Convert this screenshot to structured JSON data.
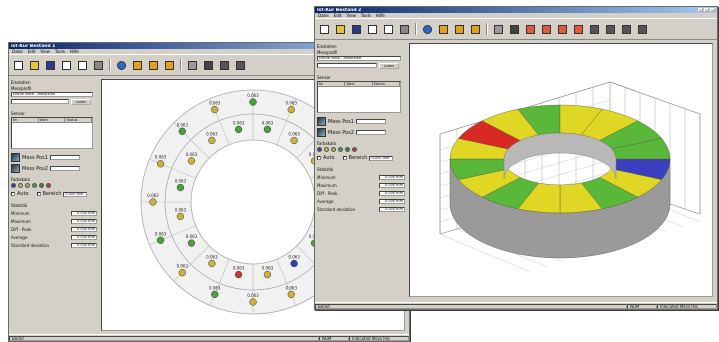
{
  "window1": {
    "title": "Ist-Kur Bestand 1",
    "menu": [
      "Datei",
      "Edit",
      "View",
      "Tools",
      "Hilfe"
    ],
    "toolbar_icons": [
      "new-icon",
      "open-icon",
      "save-icon",
      "copy-icon",
      "paste-icon",
      "print-icon",
      "info-icon",
      "folder-a-icon",
      "folder-b-icon",
      "folder-c-icon",
      "grid-icon",
      "link-icon",
      "tool-a-icon",
      "tool-b-icon"
    ],
    "panel": {
      "settings_label": "Einstellen",
      "profile_label": "Messprofil",
      "profile_value": "Ebene Mitte - Messreihe",
      "load_button": "Laden",
      "sensor_label": "Sensor",
      "list_headers": [
        "Nr",
        "Wert",
        "Status"
      ],
      "sensor1_label": "Mess Pos1",
      "sensor2_label": "Mess Pos2",
      "colors_label": "Farbskala",
      "auto_label": "Auto",
      "range_label": "Bereich",
      "range_value": "0.000 mm",
      "stats_label": "Statistik",
      "stats": [
        {
          "label": "Minimum",
          "value": "0.000 mm"
        },
        {
          "label": "Maximum",
          "value": "0.000 mm"
        },
        {
          "label": "Diff - Peak",
          "value": "0.000 mm"
        },
        {
          "label": "Average",
          "value": "0.000 mm"
        },
        {
          "label": "Standard deviation",
          "value": "0.000 mm"
        }
      ]
    },
    "status": [
      "Bereit",
      "NUM",
      "Indicated Mess Pos"
    ]
  },
  "window2": {
    "title": "Ist-Kur Bestand 2",
    "menu": [
      "Datei",
      "Edit",
      "View",
      "Tools",
      "Hilfe"
    ],
    "toolbar_icons": [
      "new-icon",
      "open-icon",
      "save-icon",
      "copy-icon",
      "paste-icon",
      "print-icon",
      "info-icon",
      "folder-a-icon",
      "folder-b-icon",
      "folder-c-icon",
      "grid-icon",
      "link-icon",
      "box-a-icon",
      "box-b-icon",
      "box-c-icon",
      "box-d-icon",
      "tool-a-icon",
      "tool-b-icon",
      "tool-c-icon",
      "tool-d-icon"
    ],
    "panel": {
      "settings_label": "Einstellen",
      "profile_label": "Messprofil",
      "profile_value": "Ebene Mitte - Messreihe",
      "load_button": "Laden",
      "sensor_label": "Sensor",
      "list_headers": [
        "Nr",
        "Wert",
        "Status"
      ],
      "sensor1_label": "Mess Pos1",
      "sensor2_label": "Mess Pos2",
      "colors_label": "Farbskala",
      "auto_label": "Auto",
      "range_label": "Bereich",
      "range_value": "0.000 mm",
      "stats_label": "Statistik",
      "stats": [
        {
          "label": "Minimum",
          "value": "0.000 mm"
        },
        {
          "label": "Maximum",
          "value": "0.000 mm"
        },
        {
          "label": "Diff - Peak",
          "value": "0.000 mm"
        },
        {
          "label": "Average",
          "value": "0.000 mm"
        },
        {
          "label": "Standard deviation",
          "value": "0.000 mm"
        }
      ]
    },
    "status": [
      "Bereit",
      "NUM",
      "Indicated Mess Pos"
    ]
  },
  "legend_colors": [
    "#2f3fb0",
    "#c9b33a",
    "#9bbf3a",
    "#4aa23a",
    "#2f8f3a",
    "#c63a2a"
  ],
  "ring_points": [
    {
      "label": "0.063",
      "color": "#4aa23a"
    },
    {
      "label": "0.063",
      "color": "#c9b33a"
    },
    {
      "label": "0.063",
      "color": "#4aa23a"
    },
    {
      "label": "0.063",
      "color": "#c9b33a"
    },
    {
      "label": "0.063",
      "color": "#4aa23a"
    },
    {
      "label": "0.063",
      "color": "#c9b33a"
    },
    {
      "label": "0.063",
      "color": "#4aa23a"
    },
    {
      "label": "0.063",
      "color": "#c9b33a"
    },
    {
      "label": "0.063",
      "color": "#c9b33a"
    },
    {
      "label": "0.063",
      "color": "#4aa23a"
    },
    {
      "label": "0.063",
      "color": "#c9b33a"
    },
    {
      "label": "0.063",
      "color": "#4aa23a"
    },
    {
      "label": "0.063",
      "color": "#c9b33a"
    },
    {
      "label": "0.063",
      "color": "#c9b33a"
    },
    {
      "label": "0.063",
      "color": "#4aa23a"
    },
    {
      "label": "0.063",
      "color": "#c9b33a"
    },
    {
      "label": "0.063",
      "color": "#4aa23a"
    },
    {
      "label": "0.063",
      "color": "#c9b33a"
    },
    {
      "label": "0.063",
      "color": "#c9b33a"
    },
    {
      "label": "0.063",
      "color": "#4aa23a"
    },
    {
      "label": "0.063",
      "color": "#c9b33a"
    },
    {
      "label": "0.063",
      "color": "#4aa23a"
    },
    {
      "label": "0.063",
      "color": "#2f3fb0"
    },
    {
      "label": "0.063",
      "color": "#c9b33a"
    },
    {
      "label": "0.063",
      "color": "#c63a2a"
    },
    {
      "label": "0.063",
      "color": "#c9b33a"
    },
    {
      "label": "0.063",
      "color": "#4aa23a"
    },
    {
      "label": "0.063",
      "color": "#c9b33a"
    },
    {
      "label": "0.063",
      "color": "#4aa23a"
    },
    {
      "label": "0.063",
      "color": "#c9b33a"
    },
    {
      "label": "0.063",
      "color": "#c9b33a"
    },
    {
      "label": "0.063",
      "color": "#4aa23a"
    }
  ],
  "ring3d_segments": [
    "#3a3fc0",
    "#e0d624",
    "#59b83a",
    "#e0d624",
    "#e0d624",
    "#59b83a",
    "#e0d624",
    "#59b83a",
    "#e0d624",
    "#d62a22",
    "#e0d624",
    "#59b83a",
    "#e0d624",
    "#e0d624",
    "#59b83a",
    "#59b83a"
  ]
}
